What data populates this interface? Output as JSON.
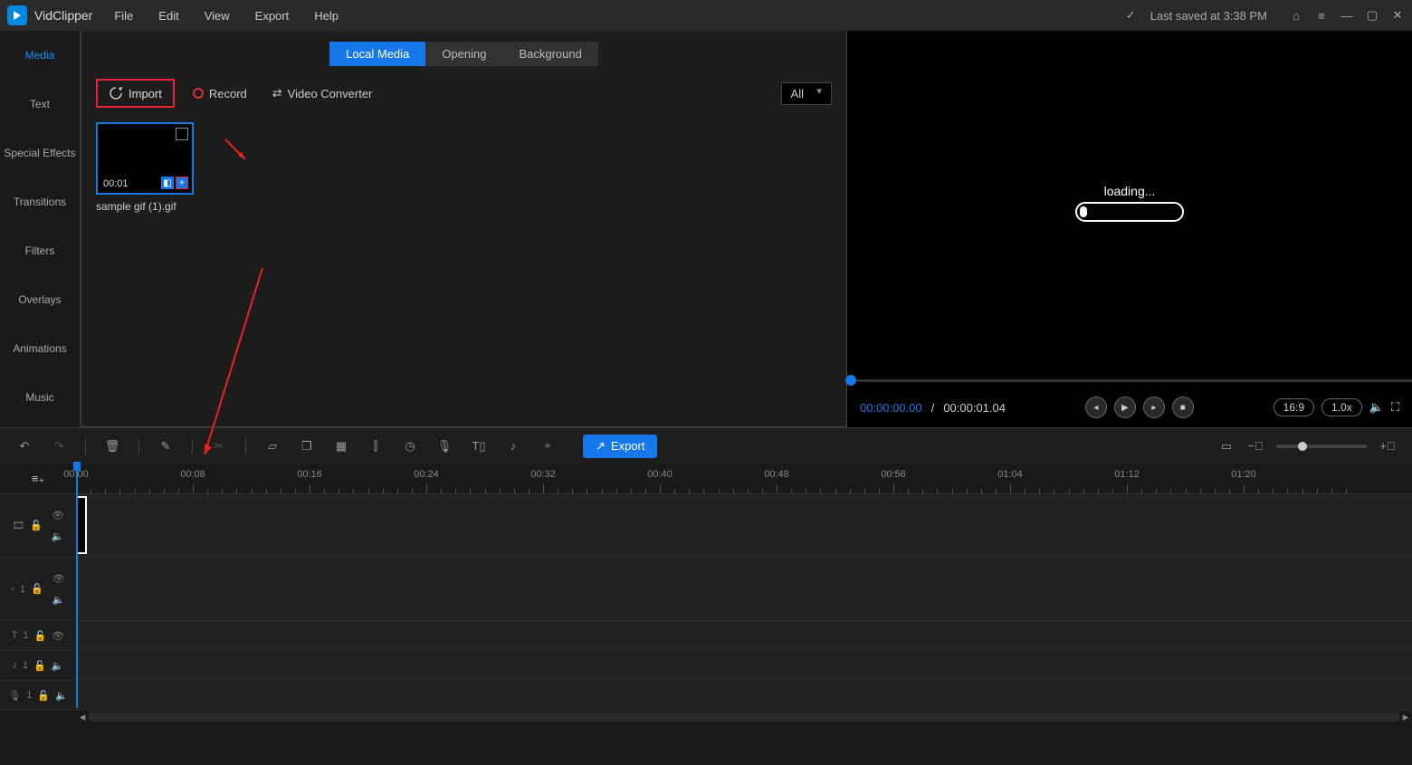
{
  "app": {
    "name": "VidClipper"
  },
  "menu": {
    "file": "File",
    "edit": "Edit",
    "view": "View",
    "export": "Export",
    "help": "Help"
  },
  "status": {
    "last_saved": "Last saved at 3:38 PM"
  },
  "sidebar": {
    "items": [
      {
        "label": "Media"
      },
      {
        "label": "Text"
      },
      {
        "label": "Special Effects"
      },
      {
        "label": "Transitions"
      },
      {
        "label": "Filters"
      },
      {
        "label": "Overlays"
      },
      {
        "label": "Animations"
      },
      {
        "label": "Music"
      }
    ]
  },
  "panel": {
    "tabs": {
      "local": "Local Media",
      "opening": "Opening",
      "background": "Background"
    },
    "import": "Import",
    "record": "Record",
    "converter": "Video Converter",
    "filter": "All"
  },
  "media": {
    "duration": "00:01",
    "filename": "sample gif (1).gif"
  },
  "preview": {
    "loading": "loading...",
    "time_current": "00:00:00.00",
    "time_total": "00:00:01.04",
    "aspect": "16:9",
    "speed": "1.0x"
  },
  "toolbar": {
    "export": "Export"
  },
  "timeline": {
    "marks": [
      "00:00",
      "00:08",
      "00:16",
      "00:24",
      "00:32",
      "00:40",
      "00:48",
      "00:56",
      "01:04",
      "01:12",
      "01:20"
    ]
  },
  "tracks": {
    "overlay_num": "1",
    "text_num": "1",
    "audio_num": "1",
    "voice_num": "1"
  }
}
